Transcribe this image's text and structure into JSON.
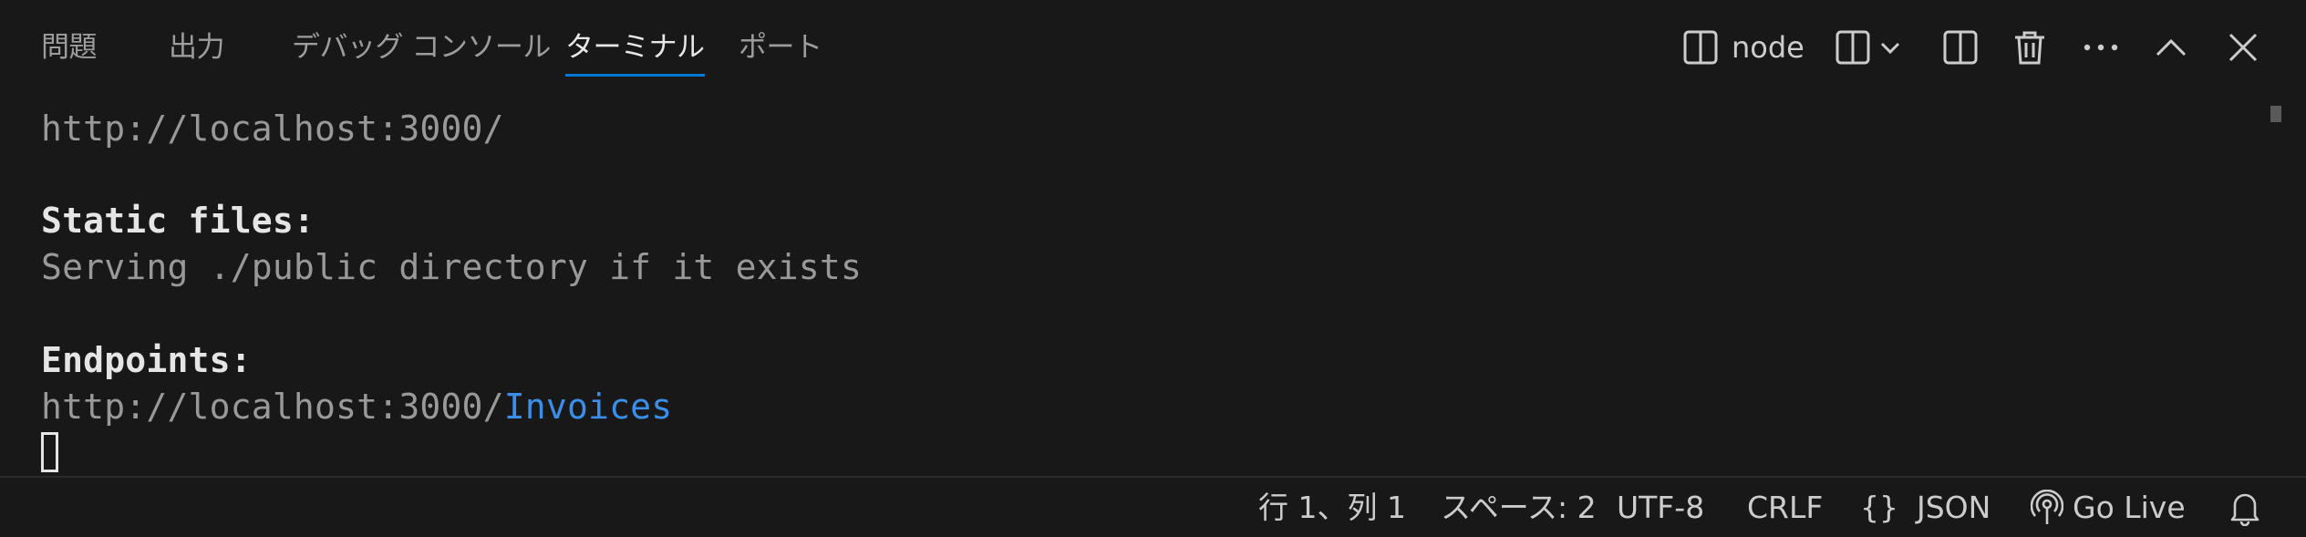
{
  "panel": {
    "tabs": [
      {
        "label": "問題",
        "active": false
      },
      {
        "label": "出力",
        "active": false
      },
      {
        "label": "デバッグ コンソール",
        "active": false
      },
      {
        "label": "ターミナル",
        "active": true
      },
      {
        "label": "ポート",
        "active": false
      }
    ],
    "toolbar": {
      "terminal_name": "node",
      "icons": [
        "terminal-split-layout-icon",
        "split-dropdown-icon",
        "chevron-down-icon",
        "split-terminal-icon",
        "trash-icon",
        "more-icon",
        "maximize-panel-icon",
        "close-icon"
      ]
    }
  },
  "terminal": {
    "lines": {
      "url_line": "http://localhost:3000/",
      "static_header": "Static files:",
      "static_desc": "Serving ./public directory if it exists",
      "endpoints_header": "Endpoints:",
      "endpoint_base": "http://localhost:3000/",
      "endpoint_name": "Invoices"
    }
  },
  "statusbar": {
    "position": "行 1、列 1",
    "indent": "スペース: 2",
    "encoding": "UTF-8",
    "eol": "CRLF",
    "language_braces": "{}",
    "language": "JSON",
    "go_live": "Go Live"
  },
  "colors": {
    "background": "#181818",
    "accent": "#0078d4",
    "link": "#3b8eea",
    "text": "#cccccc"
  }
}
